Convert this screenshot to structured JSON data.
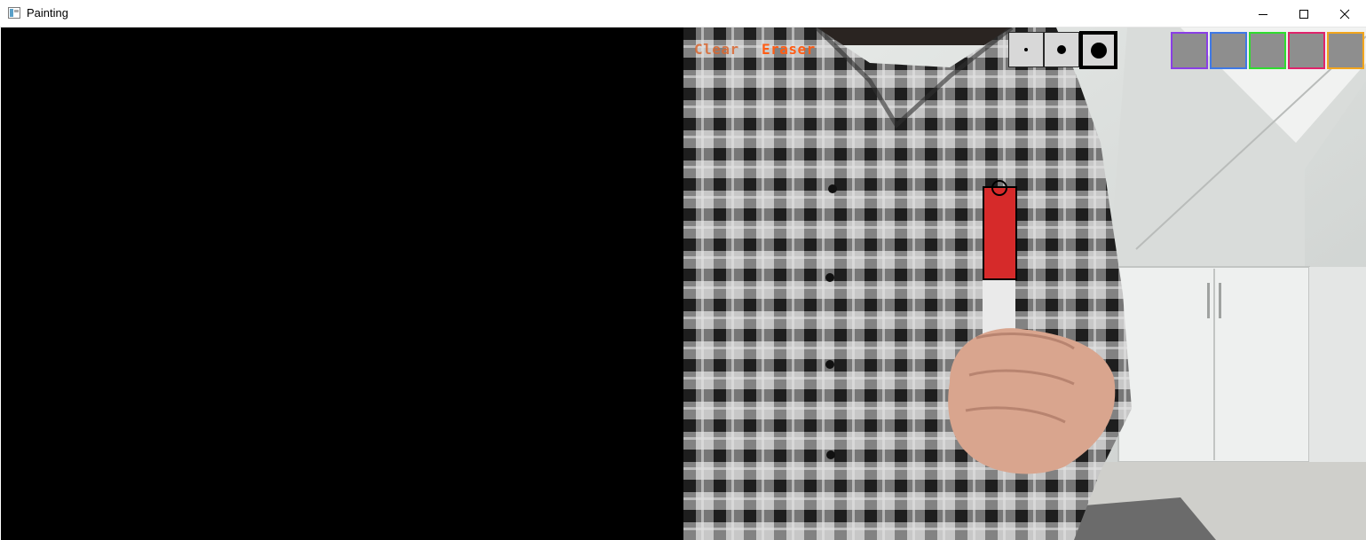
{
  "window": {
    "title": "Painting"
  },
  "toolbar": {
    "clear_label": "Clear",
    "eraser_label": "Eraser",
    "brush_sizes": [
      "small",
      "medium",
      "large"
    ],
    "selected_brush_size": "large",
    "colors": [
      "#8a3ee6",
      "#3f79e6",
      "#2fdc2f",
      "#e0236b",
      "#f2a51d"
    ]
  },
  "colors": {
    "overlay_accent": "#ff5c14",
    "canvas_background": "#000000",
    "marker_highlight": "#d62a2a"
  },
  "icons": {
    "app": "painting-window-icon",
    "minimize": "minimize-icon",
    "maximize": "maximize-icon",
    "close": "close-icon"
  }
}
